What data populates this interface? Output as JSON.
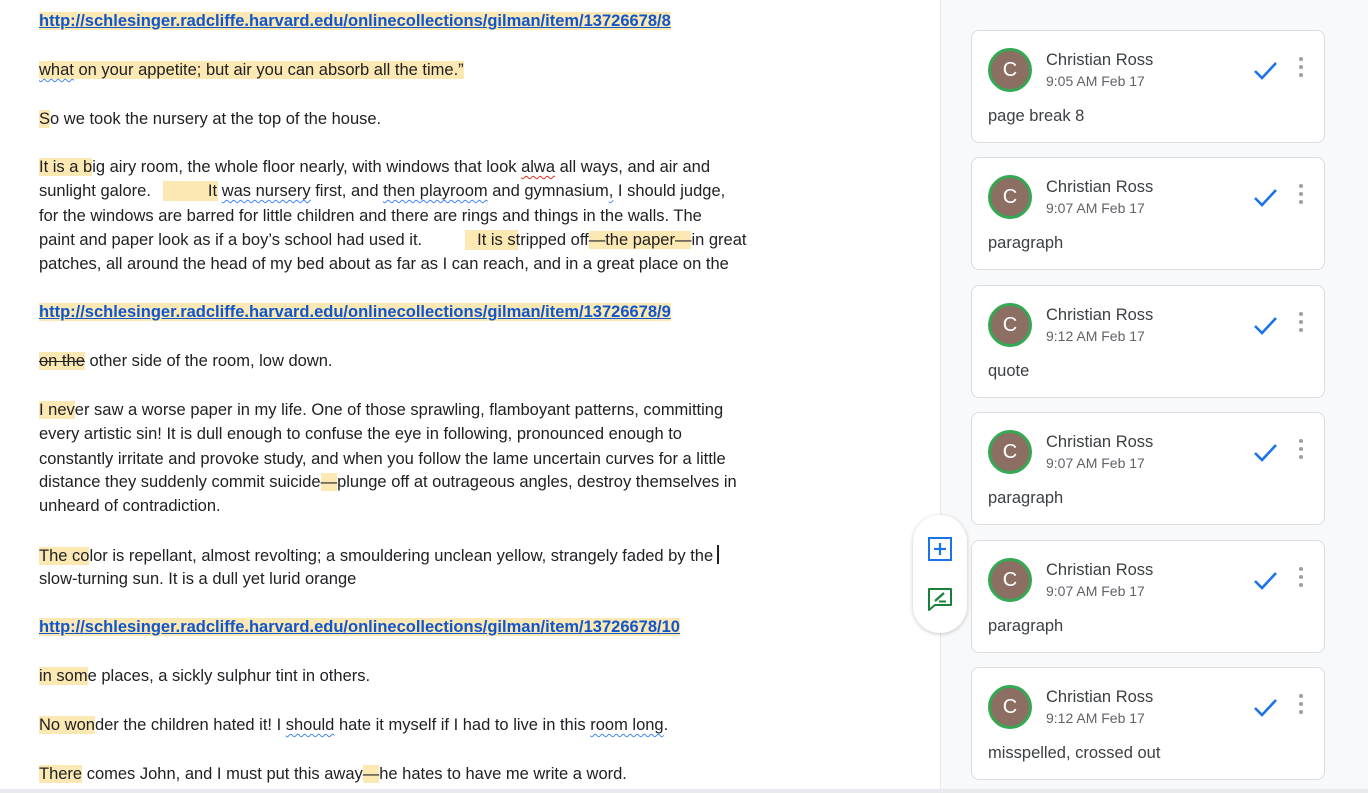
{
  "document": {
    "lines": {
      "l1": {
        "link": "http://schlesinger.radcliffe.harvard.edu/onlinecollections/gilman/item/13726678/8"
      },
      "l2": {
        "a": "what",
        "b": " on your appetite; but air you can absorb all the time.”"
      },
      "l3": {
        "a": "S",
        "b": "o we took the nursery at the top of the house."
      },
      "l4": {
        "a": "It is a b",
        "b": "ig airy room, the whole floor nearly, with windows that look ",
        "c": "alwa",
        "d": " all ways, and air and"
      },
      "l5": {
        "a": "sunlight galore.",
        "b": "It ",
        "c": "was nursery",
        "d": " first, and ",
        "e": "then playroom",
        "f": " and gymnasium",
        "g": ",",
        "h": " I should judge,"
      },
      "l6": {
        "a": "for the windows are barred for little children and there are rings and things in the walls. The"
      },
      "l7": {
        "a": "paint and paper look as if a boy’s school had used it.",
        "b": "It is stripped off",
        "c": "—the paper—",
        "d": "in great"
      },
      "l8": {
        "a": "patches, all around the head of my bed about as far as I can reach, and in a great place on the"
      },
      "l9": {
        "link": "http://schlesinger.radcliffe.harvard.edu/onlinecollections/gilman/item/13726678/9"
      },
      "l10": {
        "a": "on the",
        "b": " other side of the room, low down."
      },
      "l11": {
        "a": "I nev",
        "b": "er saw a worse paper in my life. One of those sprawling, flamboyant patterns, committing"
      },
      "l12": {
        "a": "every artistic sin! It is dull enough to confuse the eye in following, pronounced enough to"
      },
      "l13": {
        "a": "constantly irritate and provoke study, and when you follow the lame uncertain curves for a little"
      },
      "l14": {
        "a": "distance they suddenly commit suicide",
        "b": "—",
        "c": "plunge off at outrageous angles, destroy themselves in"
      },
      "l15": {
        "a": "unheard of contradiction."
      },
      "l16": {
        "a": "The co",
        "b": "lor is repellant, almost revolting; a smouldering unclean yellow, strangely faded by the"
      },
      "l17": {
        "a": "slow-turning sun. It is a dull yet lurid orange"
      },
      "l18": {
        "link": "http://schlesinger.radcliffe.harvard.edu/onlinecollections/gilman/item/13726678/10"
      },
      "l19": {
        "a": "in som",
        "b": "e places, a sickly sulphur tint in others."
      },
      "l20": {
        "a": "No won",
        "b": "der the children hated it! I ",
        "c": "should",
        "d": " hate it myself if I had to live in this ",
        "e": "room long",
        "f": "."
      },
      "l21": {
        "a": "There",
        "b": " comes John, and I must put this away",
        "c": "—",
        "d": "he hates to have me write a word."
      }
    }
  },
  "comments": [
    {
      "initial": "C",
      "author": "Christian Ross",
      "time": "9:05 AM Feb 17",
      "text": "page break 8"
    },
    {
      "initial": "C",
      "author": "Christian Ross",
      "time": "9:07 AM Feb 17",
      "text": "paragraph"
    },
    {
      "initial": "C",
      "author": "Christian Ross",
      "time": "9:12 AM Feb 17",
      "text": "quote"
    },
    {
      "initial": "C",
      "author": "Christian Ross",
      "time": "9:07 AM Feb 17",
      "text": "paragraph"
    },
    {
      "initial": "C",
      "author": "Christian Ross",
      "time": "9:07 AM Feb 17",
      "text": "paragraph"
    },
    {
      "initial": "C",
      "author": "Christian Ross",
      "time": "9:12 AM Feb 17",
      "text": "misspelled, crossed out"
    }
  ],
  "icons": {
    "add_comment": "add-comment-icon",
    "suggest_edit": "suggest-edit-icon",
    "resolve": "checkmark-icon",
    "more": "more-vert-icon"
  },
  "colors": {
    "highlight": "#fce8b2",
    "link": "#1155cc",
    "check": "#1a73e8",
    "avatar_ring": "#34a853",
    "avatar_fill": "#8d6e63",
    "suggest_icon": "#188038"
  }
}
